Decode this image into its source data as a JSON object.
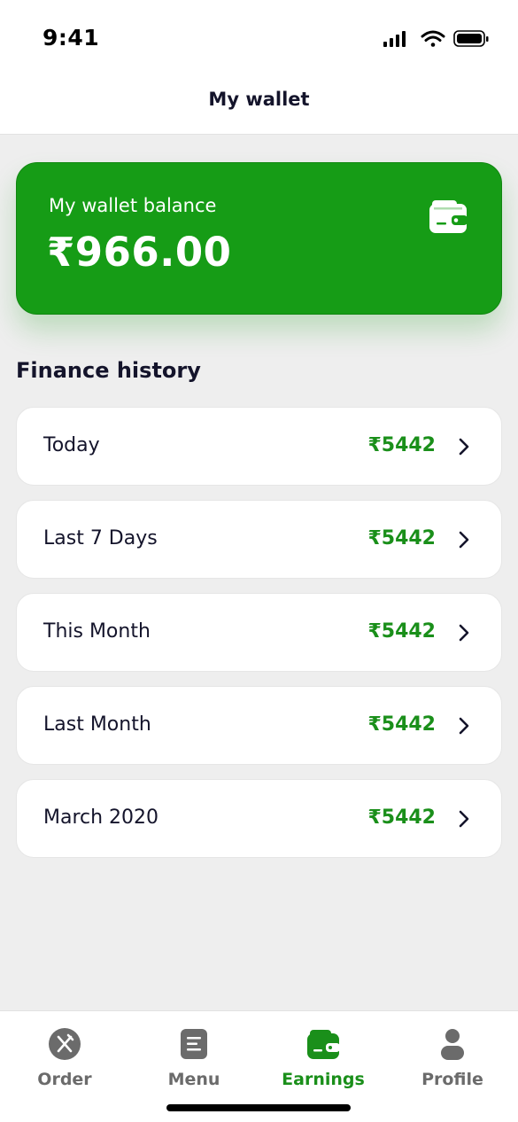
{
  "status_bar": {
    "time": "9:41"
  },
  "header": {
    "title": "My wallet"
  },
  "wallet": {
    "label": "My wallet balance",
    "amount": "₹966.00",
    "icon": "wallet-icon"
  },
  "finance": {
    "title": "Finance history",
    "items": [
      {
        "label": "Today",
        "amount": "₹5442"
      },
      {
        "label": "Last 7 Days",
        "amount": "₹5442"
      },
      {
        "label": "This Month",
        "amount": "₹5442"
      },
      {
        "label": "Last Month",
        "amount": "₹5442"
      },
      {
        "label": "March 2020",
        "amount": "₹5442"
      }
    ]
  },
  "nav": {
    "items": [
      {
        "label": "Order",
        "icon": "fork-knife-icon",
        "active": false
      },
      {
        "label": "Menu",
        "icon": "document-icon",
        "active": false
      },
      {
        "label": "Earnings",
        "icon": "wallet-icon",
        "active": true
      },
      {
        "label": "Profile",
        "icon": "user-icon",
        "active": false
      }
    ]
  },
  "colors": {
    "accent": "#169c16",
    "amount_green": "#1a8f1a",
    "background": "#eeeeee",
    "text_dark": "#14142b",
    "nav_inactive": "#6b6b6b"
  }
}
